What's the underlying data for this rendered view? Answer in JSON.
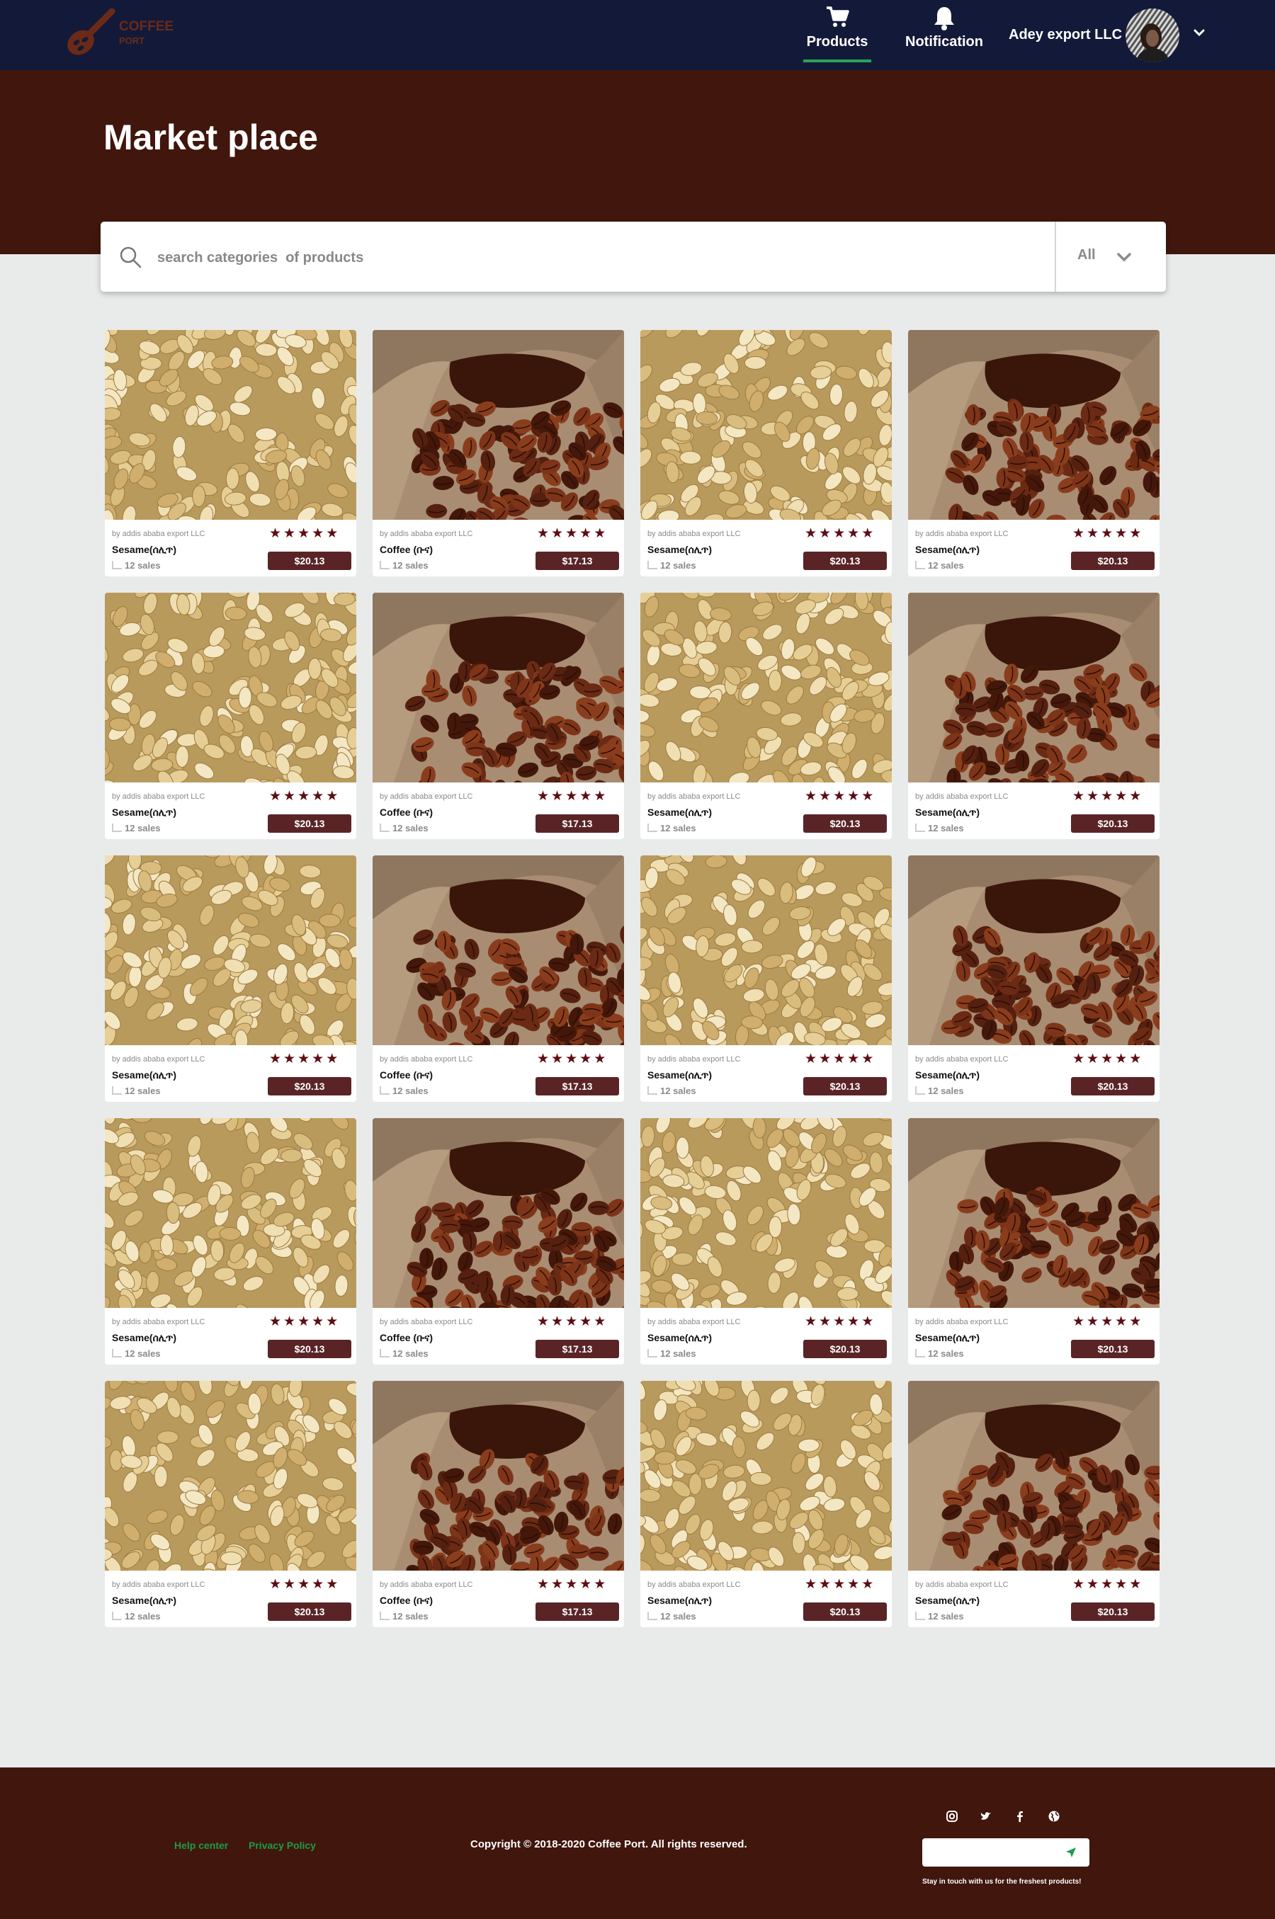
{
  "brand": {
    "line1": "COFFEE",
    "line2": "PORT"
  },
  "nav": {
    "products_label": "Products",
    "notification_label": "Notification",
    "user_name": "Adey export LLC"
  },
  "page": {
    "title": "Market place"
  },
  "search": {
    "placeholder": "search categories  of products",
    "category_selected": "All"
  },
  "products": [
    {
      "type": "sesame",
      "seller": "by addis ababa export LLC",
      "name": "Sesame(ሰሊጥ)",
      "sales": "12 sales",
      "price": "$20.13",
      "rating": 5
    },
    {
      "type": "coffee",
      "seller": "by addis ababa export LLC",
      "name": "Coffee (ቡና)",
      "sales": "12 sales",
      "price": "$17.13",
      "rating": 5
    },
    {
      "type": "sesame",
      "seller": "by addis ababa export LLC",
      "name": "Sesame(ሰሊጥ)",
      "sales": "12 sales",
      "price": "$20.13",
      "rating": 5
    },
    {
      "type": "coffee",
      "seller": "by addis ababa export LLC",
      "name": "Sesame(ሰሊጥ)",
      "sales": "12 sales",
      "price": "$20.13",
      "rating": 5
    },
    {
      "type": "sesame",
      "seller": "by addis ababa export LLC",
      "name": "Sesame(ሰሊጥ)",
      "sales": "12 sales",
      "price": "$20.13",
      "rating": 5
    },
    {
      "type": "coffee",
      "seller": "by addis ababa export LLC",
      "name": "Coffee (ቡና)",
      "sales": "12 sales",
      "price": "$17.13",
      "rating": 5
    },
    {
      "type": "sesame",
      "seller": "by addis ababa export LLC",
      "name": "Sesame(ሰሊጥ)",
      "sales": "12 sales",
      "price": "$20.13",
      "rating": 5
    },
    {
      "type": "coffee",
      "seller": "by addis ababa export LLC",
      "name": "Sesame(ሰሊጥ)",
      "sales": "12 sales",
      "price": "$20.13",
      "rating": 5
    },
    {
      "type": "sesame",
      "seller": "by addis ababa export LLC",
      "name": "Sesame(ሰሊጥ)",
      "sales": "12 sales",
      "price": "$20.13",
      "rating": 5
    },
    {
      "type": "coffee",
      "seller": "by addis ababa export LLC",
      "name": "Coffee (ቡና)",
      "sales": "12 sales",
      "price": "$17.13",
      "rating": 5
    },
    {
      "type": "sesame",
      "seller": "by addis ababa export LLC",
      "name": "Sesame(ሰሊጥ)",
      "sales": "12 sales",
      "price": "$20.13",
      "rating": 5
    },
    {
      "type": "coffee",
      "seller": "by addis ababa export LLC",
      "name": "Sesame(ሰሊጥ)",
      "sales": "12 sales",
      "price": "$20.13",
      "rating": 5
    },
    {
      "type": "sesame",
      "seller": "by addis ababa export LLC",
      "name": "Sesame(ሰሊጥ)",
      "sales": "12 sales",
      "price": "$20.13",
      "rating": 5
    },
    {
      "type": "coffee",
      "seller": "by addis ababa export LLC",
      "name": "Coffee (ቡና)",
      "sales": "12 sales",
      "price": "$17.13",
      "rating": 5
    },
    {
      "type": "sesame",
      "seller": "by addis ababa export LLC",
      "name": "Sesame(ሰሊጥ)",
      "sales": "12 sales",
      "price": "$20.13",
      "rating": 5
    },
    {
      "type": "coffee",
      "seller": "by addis ababa export LLC",
      "name": "Sesame(ሰሊጥ)",
      "sales": "12 sales",
      "price": "$20.13",
      "rating": 5
    },
    {
      "type": "sesame",
      "seller": "by addis ababa export LLC",
      "name": "Sesame(ሰሊጥ)",
      "sales": "12 sales",
      "price": "$20.13",
      "rating": 5
    },
    {
      "type": "coffee",
      "seller": "by addis ababa export LLC",
      "name": "Coffee (ቡና)",
      "sales": "12 sales",
      "price": "$17.13",
      "rating": 5
    },
    {
      "type": "sesame",
      "seller": "by addis ababa export LLC",
      "name": "Sesame(ሰሊጥ)",
      "sales": "12 sales",
      "price": "$20.13",
      "rating": 5
    },
    {
      "type": "coffee",
      "seller": "by addis ababa export LLC",
      "name": "Sesame(ሰሊጥ)",
      "sales": "12 sales",
      "price": "$20.13",
      "rating": 5
    }
  ],
  "footer": {
    "help_center": "Help center",
    "privacy_policy": "Privacy Policy",
    "copyright": "Copyright © 2018-2020 Coffee Port. All rights reserved.",
    "newsletter_note": "Stay in touch with us for the freshest products!",
    "social_icons": [
      "instagram-icon",
      "twitter-icon",
      "facebook-icon",
      "globe-icon"
    ]
  },
  "colors": {
    "navbar": "#131a39",
    "hero": "#40160d",
    "accent_green": "#27a45b",
    "price_badge": "#5a2426",
    "star": "#5b0e13"
  }
}
